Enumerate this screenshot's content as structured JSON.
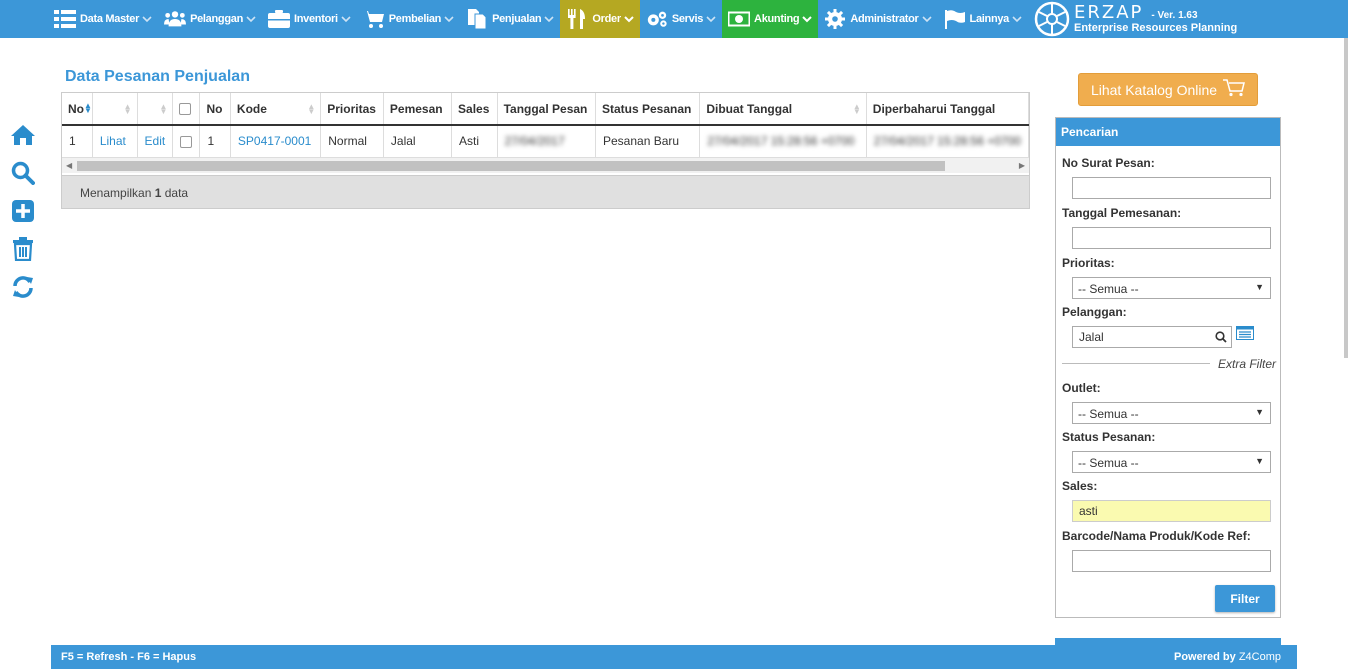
{
  "nav": {
    "items": [
      {
        "label": "Data Master"
      },
      {
        "label": "Pelanggan"
      },
      {
        "label": "Inventori"
      },
      {
        "label": "Pembelian"
      },
      {
        "label": "Penjualan"
      },
      {
        "label": "Order"
      },
      {
        "label": "Servis"
      },
      {
        "label": "Akunting"
      },
      {
        "label": "Administrator"
      },
      {
        "label": "Lainnya"
      }
    ],
    "brand_name": "ERZAP",
    "brand_version": "- Ver. 1.63",
    "brand_sub": "Enterprise Resources Planning",
    "colors": {
      "bar": "#3c97d8",
      "order": "#b5a822",
      "akunting": "#2db33e"
    }
  },
  "main": {
    "title": "Data Pesanan Penjualan",
    "columns": [
      "No",
      "",
      "",
      "",
      "No",
      "Kode",
      "Prioritas",
      "Pemesan",
      "Sales",
      "Tanggal Pesan",
      "Status Pesanan",
      "Dibuat Tanggal",
      "Diperbaharui Tanggal"
    ],
    "rows": [
      {
        "no": "1",
        "view": "Lihat",
        "edit": "Edit",
        "no2": "1",
        "kode": "SP0417-0001",
        "prioritas": "Normal",
        "pemesan": "Jalal",
        "sales": "Asti",
        "tanggal_pesan": "27/04/2017",
        "status": "Pesanan Baru",
        "dibuat": "27/04/2017 15:28:56 +0700",
        "diperbaharui": "27/04/2017 15:28:56 +0700"
      }
    ],
    "footer_prefix": "Menampilkan",
    "footer_count": "1",
    "footer_suffix": "data"
  },
  "sidebar": {
    "katalog_label": "Lihat Katalog Online",
    "panel_title": "Pencarian",
    "fields": {
      "no_surat": {
        "label": "No Surat Pesan:",
        "value": ""
      },
      "tanggal": {
        "label": "Tanggal Pemesanan:",
        "value": ""
      },
      "prioritas": {
        "label": "Prioritas:",
        "value": "-- Semua --"
      },
      "pelanggan": {
        "label": "Pelanggan:",
        "value": "Jalal"
      },
      "extra": "Extra Filter",
      "outlet": {
        "label": "Outlet:",
        "value": "-- Semua --"
      },
      "status": {
        "label": "Status Pesanan:",
        "value": "-- Semua --"
      },
      "sales": {
        "label": "Sales:",
        "value": "asti"
      },
      "barcode": {
        "label": "Barcode/Nama Produk/Kode Ref:",
        "value": ""
      }
    },
    "filter_label": "Filter"
  },
  "footer": {
    "shortcuts": "F5 = Refresh - F6 = Hapus",
    "powered_prefix": "Powered by",
    "powered_brand": "Z4Comp"
  }
}
